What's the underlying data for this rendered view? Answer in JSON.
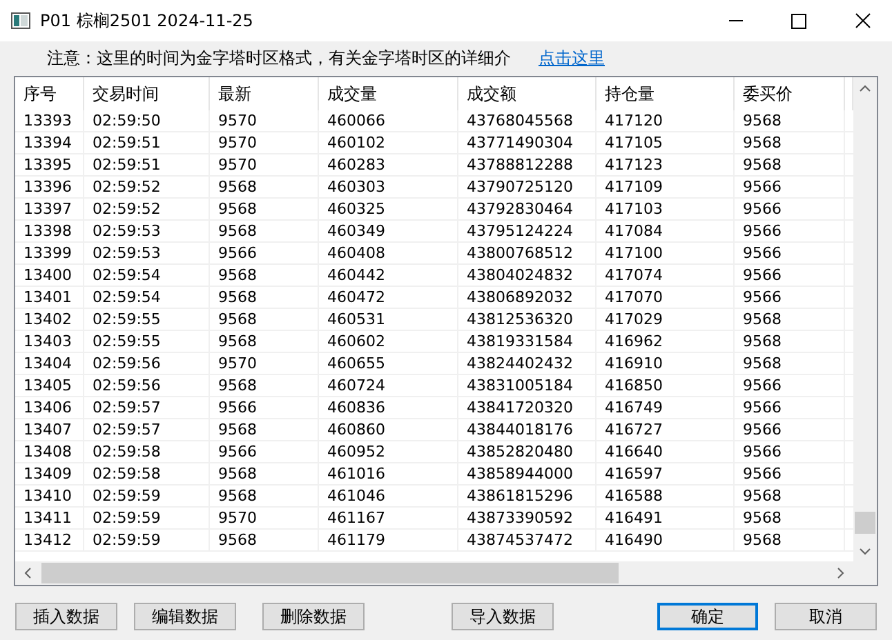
{
  "window": {
    "title": "P01 棕榈2501 2024-11-25"
  },
  "notice": {
    "text": "注意：这里的时间为金字塔时区格式，有关金字塔时区的详细介",
    "link": "点击这里"
  },
  "table": {
    "columns": [
      "序号",
      "交易时间",
      "最新",
      "成交量",
      "成交额",
      "持仓量",
      "委买价"
    ],
    "rows": [
      [
        "13393",
        "02:59:50",
        "9570",
        "460066",
        "43768045568",
        "417120",
        "9568"
      ],
      [
        "13394",
        "02:59:51",
        "9570",
        "460102",
        "43771490304",
        "417105",
        "9568"
      ],
      [
        "13395",
        "02:59:51",
        "9570",
        "460283",
        "43788812288",
        "417123",
        "9568"
      ],
      [
        "13396",
        "02:59:52",
        "9568",
        "460303",
        "43790725120",
        "417109",
        "9566"
      ],
      [
        "13397",
        "02:59:52",
        "9568",
        "460325",
        "43792830464",
        "417103",
        "9566"
      ],
      [
        "13398",
        "02:59:53",
        "9568",
        "460349",
        "43795124224",
        "417084",
        "9566"
      ],
      [
        "13399",
        "02:59:53",
        "9566",
        "460408",
        "43800768512",
        "417100",
        "9566"
      ],
      [
        "13400",
        "02:59:54",
        "9568",
        "460442",
        "43804024832",
        "417074",
        "9566"
      ],
      [
        "13401",
        "02:59:54",
        "9568",
        "460472",
        "43806892032",
        "417070",
        "9566"
      ],
      [
        "13402",
        "02:59:55",
        "9568",
        "460531",
        "43812536320",
        "417029",
        "9568"
      ],
      [
        "13403",
        "02:59:55",
        "9568",
        "460602",
        "43819331584",
        "416962",
        "9568"
      ],
      [
        "13404",
        "02:59:56",
        "9570",
        "460655",
        "43824402432",
        "416910",
        "9568"
      ],
      [
        "13405",
        "02:59:56",
        "9568",
        "460724",
        "43831005184",
        "416850",
        "9566"
      ],
      [
        "13406",
        "02:59:57",
        "9566",
        "460836",
        "43841720320",
        "416749",
        "9566"
      ],
      [
        "13407",
        "02:59:57",
        "9568",
        "460860",
        "43844018176",
        "416727",
        "9566"
      ],
      [
        "13408",
        "02:59:58",
        "9566",
        "460952",
        "43852820480",
        "416640",
        "9566"
      ],
      [
        "13409",
        "02:59:58",
        "9568",
        "461016",
        "43858944000",
        "416597",
        "9566"
      ],
      [
        "13410",
        "02:59:59",
        "9568",
        "461046",
        "43861815296",
        "416588",
        "9568"
      ],
      [
        "13411",
        "02:59:59",
        "9570",
        "461167",
        "43873390592",
        "416491",
        "9568"
      ],
      [
        "13412",
        "02:59:59",
        "9568",
        "461179",
        "43874537472",
        "416490",
        "9568"
      ]
    ]
  },
  "buttons": [
    {
      "label": "插入数据",
      "default": false
    },
    {
      "label": "编辑数据",
      "default": false
    },
    {
      "label": "删除数据",
      "default": false
    },
    {
      "label": "导入数据",
      "default": false
    },
    {
      "label": "确定",
      "default": true
    },
    {
      "label": "取消",
      "default": false
    }
  ]
}
